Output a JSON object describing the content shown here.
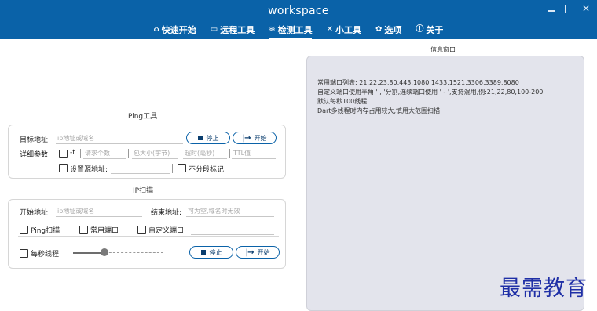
{
  "app": {
    "title": "workspace"
  },
  "window_controls": {
    "minimize_icon": "minimize-icon",
    "maximize_icon": "maximize-icon",
    "close_icon": "close-icon"
  },
  "nav": {
    "tabs": [
      {
        "label": "快速开始",
        "icon": "⌂",
        "active": false
      },
      {
        "label": "远程工具",
        "icon": "▭",
        "active": false
      },
      {
        "label": "检测工具",
        "icon": "≋",
        "active": true
      },
      {
        "label": "小工具",
        "icon": "✕",
        "active": false
      },
      {
        "label": "选项",
        "icon": "✿",
        "active": false
      },
      {
        "label": "关于",
        "icon": "ⓘ",
        "active": false
      }
    ]
  },
  "ping": {
    "title": "Ping工具",
    "target_label": "目标地址:",
    "target_placeholder": "ip地址或域名",
    "stop_label": "停止",
    "start_label": "开始",
    "params_label": "详细参数:",
    "t_label": "-t",
    "count_placeholder": "请求个数",
    "size_placeholder": "包大小(字节)",
    "timeout_placeholder": "超时(毫秒)",
    "ttl_placeholder": "TTL值",
    "source_label": "设置源地址:",
    "nofrag_label": "不分段标记"
  },
  "ipscan": {
    "title": "IP扫描",
    "start_label": "开始地址:",
    "start_placeholder": "ip地址或域名",
    "end_label": "结束地址:",
    "end_placeholder": "可为空,域名时无效",
    "ping_scan_label": "Ping扫描",
    "common_ports_label": "常用端口",
    "custom_ports_label": "自定义端口:",
    "threads_label": "每秒线程:",
    "threads_level": 0.35,
    "stop_label": "停止",
    "start_btn_label": "开始"
  },
  "info": {
    "title": "信息窗口",
    "lines": [
      "常用端口列表: 21,22,23,80,443,1080,1433,1521,3306,3389,8080",
      "自定义端口使用半角 ' , '分割,连续端口使用 ' - ',支持混用,例:21,22,80,100-200",
      "默认每秒100线程",
      "Dart多线程时内存占用较大,慎用大范围扫描"
    ]
  },
  "watermark": "最需教育",
  "colors": {
    "accent": "#0a62a8",
    "info_bg": "#e3e4ec"
  }
}
